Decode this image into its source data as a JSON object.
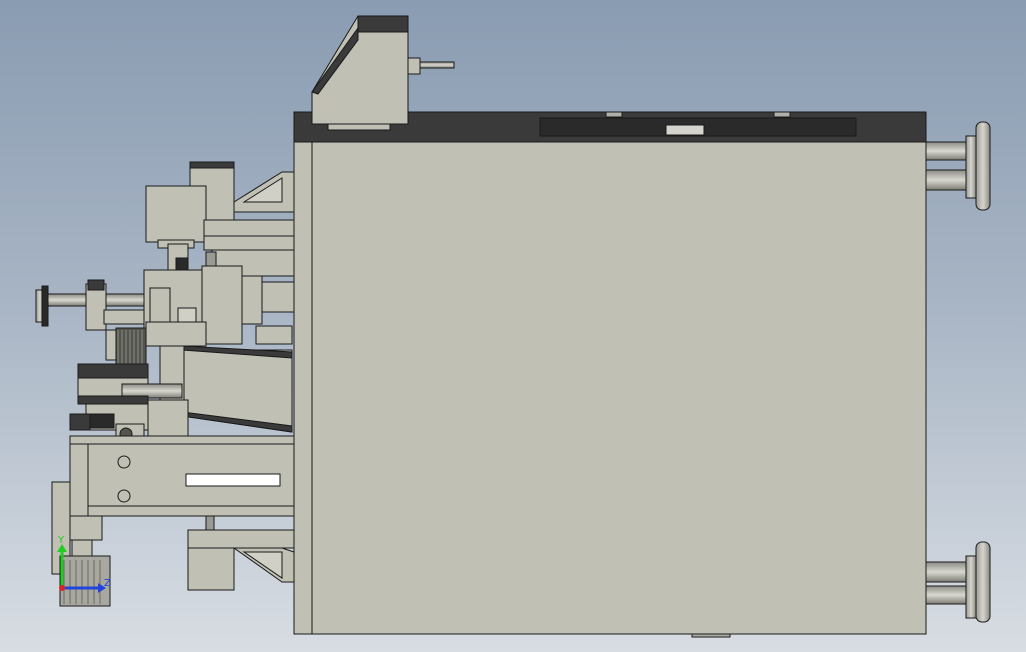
{
  "viewport": {
    "background_top": "#8a9cb2",
    "background_bottom": "#d8dde3"
  },
  "model": {
    "body_color": "#c0c0b4",
    "dark_trim": "#3a3a3a",
    "edge_color": "#1a1a1a",
    "hole_color": "#ffffff"
  },
  "triad": {
    "y_label": "Y",
    "z_label": "Z",
    "y_color": "#22cc22",
    "z_color": "#2244dd",
    "x_color": "#dd2222"
  }
}
